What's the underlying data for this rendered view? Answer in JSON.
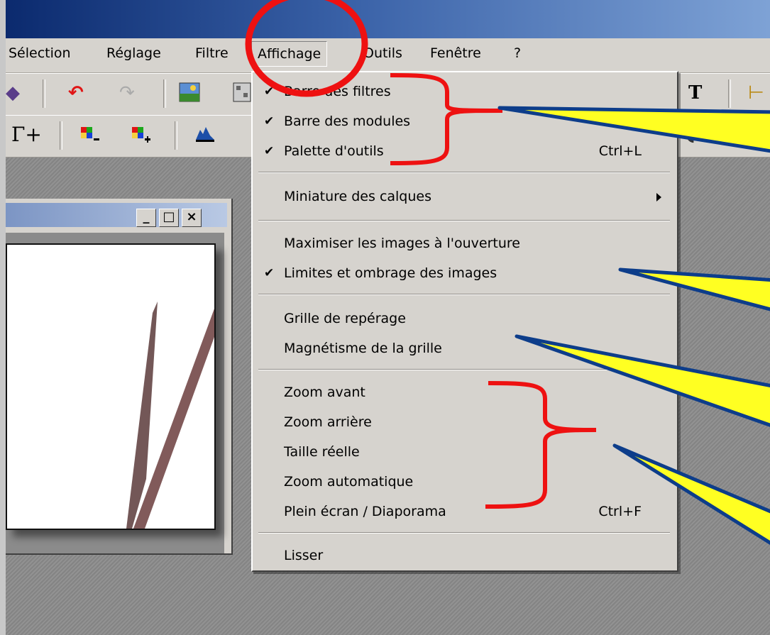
{
  "menubar": {
    "items": [
      "Sélection",
      "Réglage",
      "Filtre",
      "Affichage",
      "Outils",
      "Fenêtre",
      "?"
    ]
  },
  "toolbar2": {
    "gamma_label": "Γ+"
  },
  "menu": {
    "items": [
      {
        "label": "Barre des filtres",
        "checked": "✔"
      },
      {
        "label": "Barre des modules",
        "checked": "✔"
      },
      {
        "label": "Palette d'outils",
        "checked": "✔",
        "shortcut": "Ctrl+L"
      },
      {
        "label": "Miniature des calques"
      },
      {
        "label": "Maximiser les images à l'ouverture"
      },
      {
        "label": "Limites et ombrage des images",
        "checked": "✔"
      },
      {
        "label": "Grille de repérage"
      },
      {
        "label": "Magnétisme de la grille"
      },
      {
        "label": "Zoom avant"
      },
      {
        "label": "Zoom arrière"
      },
      {
        "label": "Taille réelle"
      },
      {
        "label": "Zoom automatique"
      },
      {
        "label": "Plein écran / Diaporama",
        "shortcut": "Ctrl+F"
      },
      {
        "label": "Lisser"
      }
    ]
  },
  "window_buttons": {
    "minimize": "_",
    "maximize": "□",
    "close": "×"
  },
  "toolbar1": {
    "text_tool": "T"
  },
  "colors": {
    "menu_bg": "#d6d3ce",
    "annotation_red": "#ee1111",
    "annotation_blue": "#0d3d8a",
    "annotation_yellow": "#ffff22",
    "titlebar_dark": "#0b2a6e"
  }
}
